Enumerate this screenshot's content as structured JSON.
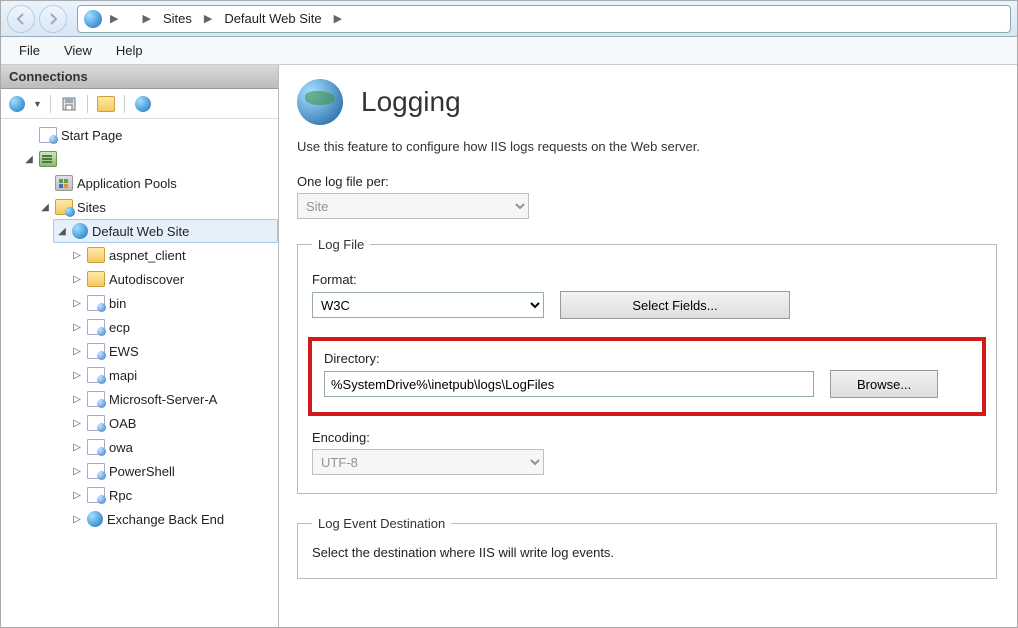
{
  "addressbar": {
    "crumbs": [
      "",
      "Sites",
      "Default Web Site",
      ""
    ]
  },
  "menubar": [
    "File",
    "View",
    "Help"
  ],
  "sidebar": {
    "header": "Connections",
    "tree": {
      "start_page": "Start Page",
      "app_pools": "Application Pools",
      "sites": "Sites",
      "default_site": "Default Web Site",
      "children": [
        "aspnet_client",
        "Autodiscover",
        "bin",
        "ecp",
        "EWS",
        "mapi",
        "Microsoft-Server-A",
        "OAB",
        "owa",
        "PowerShell",
        "Rpc",
        "Exchange Back End"
      ]
    }
  },
  "content": {
    "title": "Logging",
    "description": "Use this feature to configure how IIS logs requests on the Web server.",
    "one_per_label": "One log file per:",
    "one_per_value": "Site",
    "logfile_legend": "Log File",
    "format_label": "Format:",
    "format_value": "W3C",
    "select_fields_btn": "Select Fields...",
    "directory_label": "Directory:",
    "directory_value": "%SystemDrive%\\inetpub\\logs\\LogFiles",
    "browse_btn": "Browse...",
    "encoding_label": "Encoding:",
    "encoding_value": "UTF-8",
    "dest_legend": "Log Event Destination",
    "dest_text": "Select the destination where IIS will write log events."
  }
}
